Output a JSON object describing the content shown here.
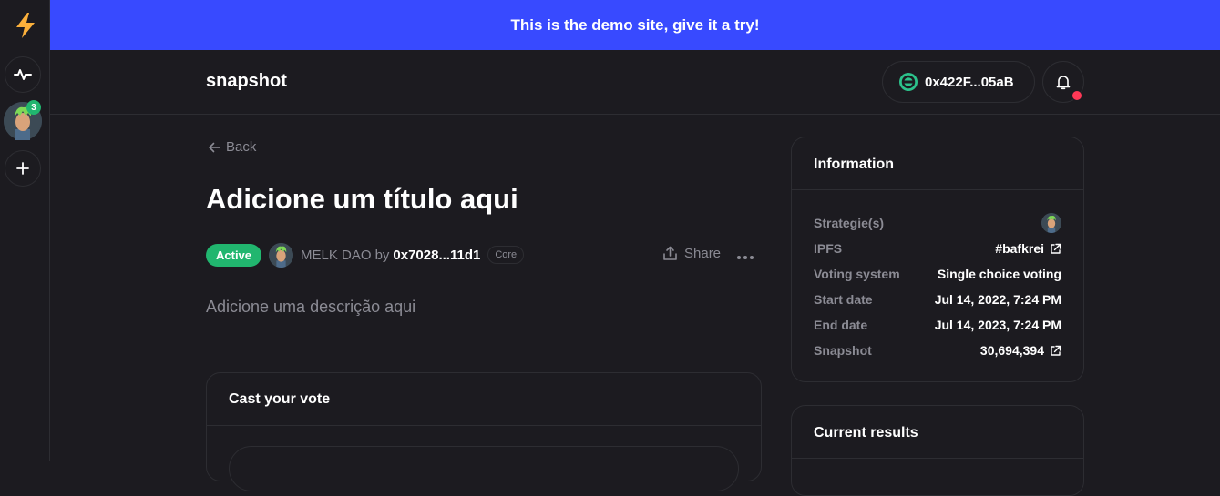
{
  "rail": {
    "avatar_badge": "3"
  },
  "banner": {
    "text": "This is the demo site, give it a try!"
  },
  "header": {
    "logo": "snapshot",
    "wallet_address": "0x422F...05aB"
  },
  "proposal": {
    "back_label": "Back",
    "title": "Adicione um título aqui",
    "status": "Active",
    "space_name": "MELK DAO",
    "by_label": "by",
    "author": "0x7028...11d1",
    "author_badge": "Core",
    "share_label": "Share",
    "description": "Adicione uma descrição aqui"
  },
  "vote": {
    "heading": "Cast your vote"
  },
  "information": {
    "heading": "Information",
    "rows": [
      {
        "label": "Strategie(s)",
        "value": ""
      },
      {
        "label": "IPFS",
        "value": "#bafkrei"
      },
      {
        "label": "Voting system",
        "value": "Single choice voting"
      },
      {
        "label": "Start date",
        "value": "Jul 14, 2022, 7:24 PM"
      },
      {
        "label": "End date",
        "value": "Jul 14, 2023, 7:24 PM"
      },
      {
        "label": "Snapshot",
        "value": "30,694,394"
      }
    ]
  },
  "results": {
    "heading": "Current results"
  },
  "colors": {
    "background": "#1c1b20",
    "banner": "#384aff",
    "active_green": "#21b66f",
    "notification_red": "#ff3856",
    "muted_text": "#8b8b94",
    "border": "#2d2d32"
  }
}
